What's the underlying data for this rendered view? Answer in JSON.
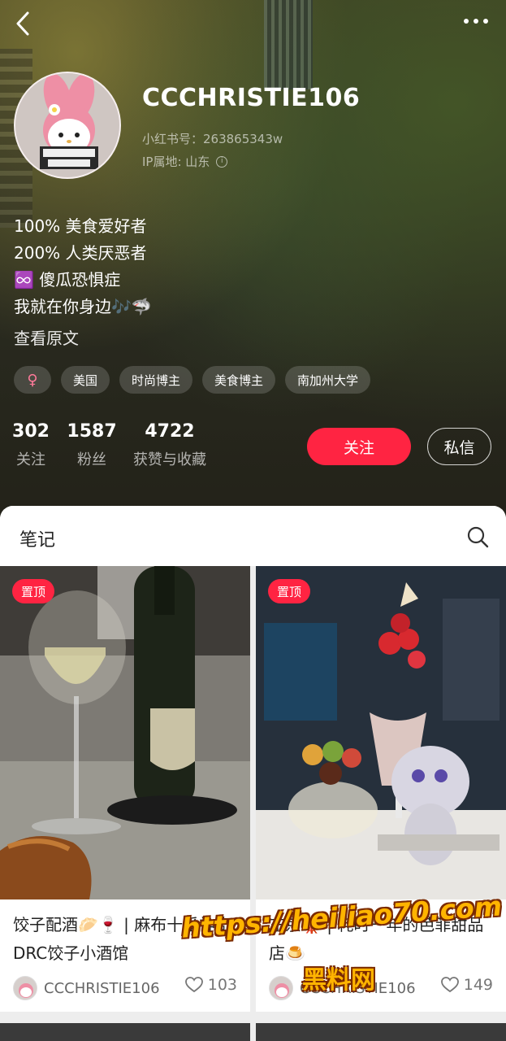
{
  "colors": {
    "accent": "#ff2442",
    "background": "#ededed",
    "watermark": "#ffb400"
  },
  "nav": {
    "back_icon": "chevron-left-icon",
    "more_icon": "more-horizontal-icon"
  },
  "profile": {
    "username": "CCCHRISTIE106",
    "redbook_id": "小红书号：263865343w",
    "ip_location": "IP属地: 山东",
    "bio": [
      "100% 美食爱好者",
      "200% 人类厌恶者",
      "♾️ 傻瓜恐惧症",
      "我就在你身边🎶🦈"
    ],
    "view_original": "查看原文",
    "tags": [
      "♀",
      "美国",
      "时尚博主",
      "美食博主",
      "南加州大学"
    ],
    "stats": [
      {
        "value": "302",
        "label": "关注"
      },
      {
        "value": "1587",
        "label": "粉丝"
      },
      {
        "value": "4722",
        "label": "获赞与收藏"
      }
    ],
    "follow_label": "关注",
    "message_label": "私信"
  },
  "notes": {
    "tab_title": "笔记",
    "cards": [
      {
        "badge": "置顶",
        "title": "饺子配酒🥟🍷 | 麻布十番神奇DRC饺子小酒馆",
        "author": "CCCHRISTIE106",
        "likes": "103"
      },
      {
        "badge": "置顶",
        "title": "东京🗼 | 耗时一年的芭菲甜品店🍮",
        "author": "CCCHRISTIE106",
        "likes": "149"
      }
    ]
  },
  "watermark": {
    "line1": "https://heiliao70.com",
    "line2": "黑料网"
  }
}
